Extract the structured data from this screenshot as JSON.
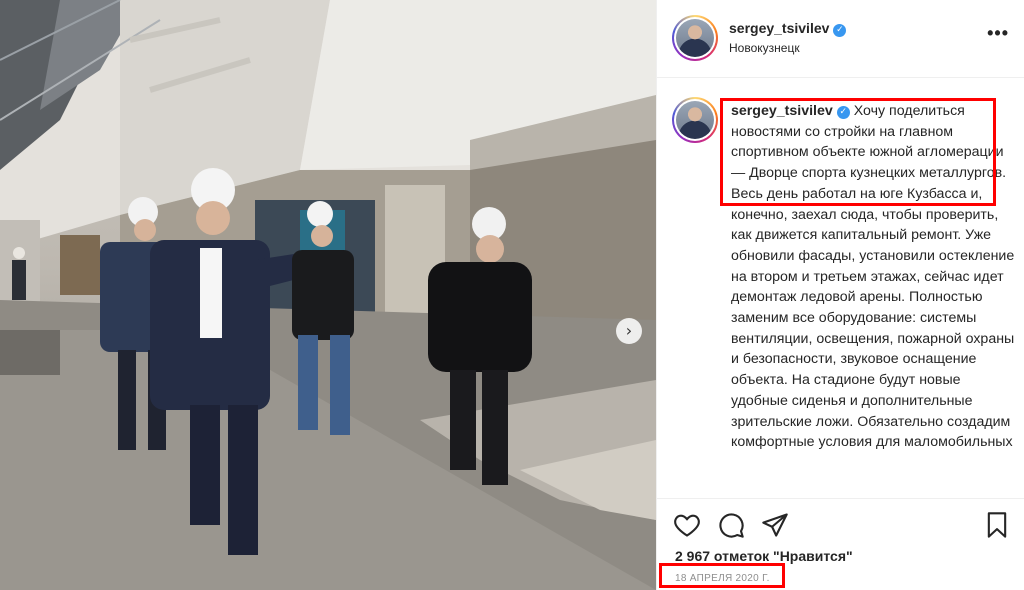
{
  "post": {
    "username": "sergey_tsivilev",
    "location": "Новокузнецк",
    "verified_glyph": "✓",
    "more_glyph": "•••",
    "caption_text": "Хочу поделиться новостями со стройки на главном спортивном объекте южной агломерации — Дворце спорта кузнецких металлургов. Весь день работал на юге Кузбасса и, конечно, заехал сюда, чтобы проверить, как движется капитальный ремонт. Уже обновили фасады, установили остекление на втором и третьем этажах, сейчас идет демонтаж ледовой арены. Полностью заменим все оборудование: системы вентиляции, освещения, пожарной охраны и безопасности, звуковое оснащение объекта. На стадионе будут новые удобные сиденья и дополнительные зрительские ложи. Обязательно создадим комфортные условия для маломобильных",
    "likes": "2 967 отметок \"Нравится\"",
    "date": "18 АПРЕЛЯ 2020 Г."
  },
  "carousel": {
    "next_glyph": "›"
  },
  "actions": [
    "heart-icon",
    "comment-icon",
    "share-icon",
    "bookmark-icon"
  ],
  "colors": {
    "verified": "#3897f0",
    "highlight": "#ff0000",
    "text": "#262626",
    "muted": "#8e8e8e"
  }
}
